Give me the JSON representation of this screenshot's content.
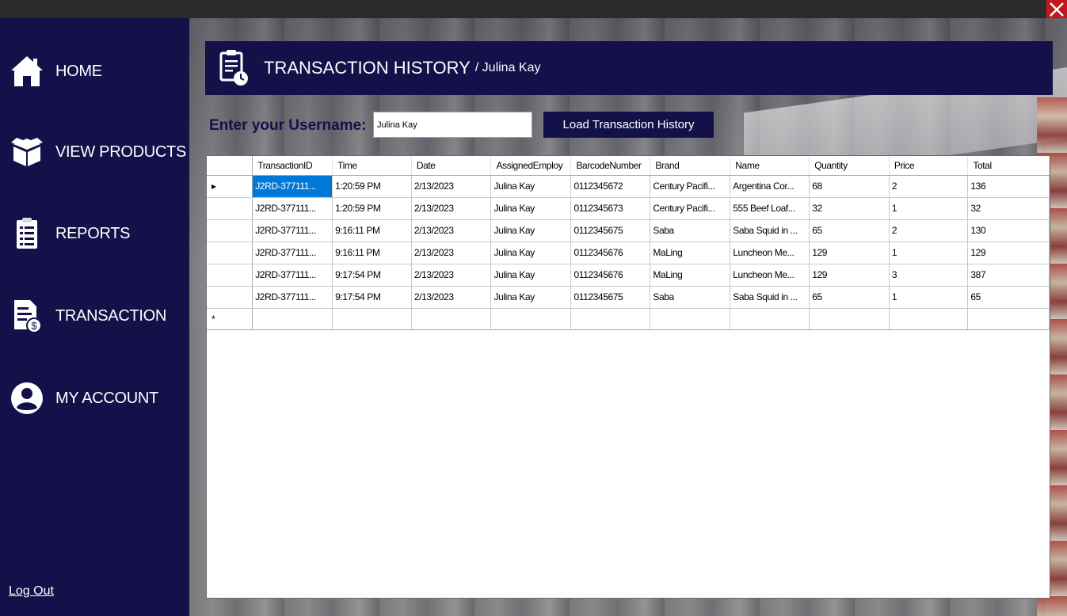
{
  "sidebar": {
    "items": [
      {
        "label": "HOME",
        "icon": "home-icon"
      },
      {
        "label": "VIEW PRODUCTS",
        "icon": "box-icon"
      },
      {
        "label": "REPORTS",
        "icon": "clipboard-icon"
      },
      {
        "label": "TRANSACTION",
        "icon": "invoice-dollar-icon"
      },
      {
        "label": "MY ACCOUNT",
        "icon": "user-circle-icon"
      }
    ],
    "logout_label": "Log Out"
  },
  "header": {
    "title": "TRANSACTION HISTORY",
    "subtitle": "/ Julina Kay",
    "icon": "clipboard-clock-icon"
  },
  "form": {
    "username_label": "Enter your Username:",
    "username_value": "Julina Kay",
    "load_button": "Load Transaction History"
  },
  "grid": {
    "columns": [
      "TransactionID",
      "Time",
      "Date",
      "AssignedEmploy",
      "BarcodeNumber",
      "Brand",
      "Name",
      "Quantity",
      "Price",
      "Total"
    ],
    "rows": [
      [
        "J2RD-377111...",
        "1:20:59 PM",
        "2/13/2023",
        "Julina Kay",
        "0112345672",
        "Century Pacifi...",
        "Argentina Cor...",
        "68",
        "2",
        "136"
      ],
      [
        "J2RD-377111...",
        "1:20:59 PM",
        "2/13/2023",
        "Julina Kay",
        "0112345673",
        "Century Pacifi...",
        "555 Beef Loaf...",
        "32",
        "1",
        "32"
      ],
      [
        "J2RD-377111...",
        "9:16:11 PM",
        "2/13/2023",
        "Julina Kay",
        "0112345675",
        "Saba",
        "Saba Squid in ...",
        "65",
        "2",
        "130"
      ],
      [
        "J2RD-377111...",
        "9:16:11 PM",
        "2/13/2023",
        "Julina Kay",
        "0112345676",
        "MaLing",
        "Luncheon Me...",
        "129",
        "1",
        "129"
      ],
      [
        "J2RD-377111...",
        "9:17:54 PM",
        "2/13/2023",
        "Julina Kay",
        "0112345676",
        "MaLing",
        "Luncheon Me...",
        "129",
        "3",
        "387"
      ],
      [
        "J2RD-377111...",
        "9:17:54 PM",
        "2/13/2023",
        "Julina Kay",
        "0112345675",
        "Saba",
        "Saba Squid in ...",
        "65",
        "1",
        "65"
      ]
    ],
    "current_row_marker": "▸",
    "new_row_marker": "*"
  },
  "colors": {
    "navy": "#14114a",
    "selection": "#0078d7",
    "close": "#c2171c"
  }
}
